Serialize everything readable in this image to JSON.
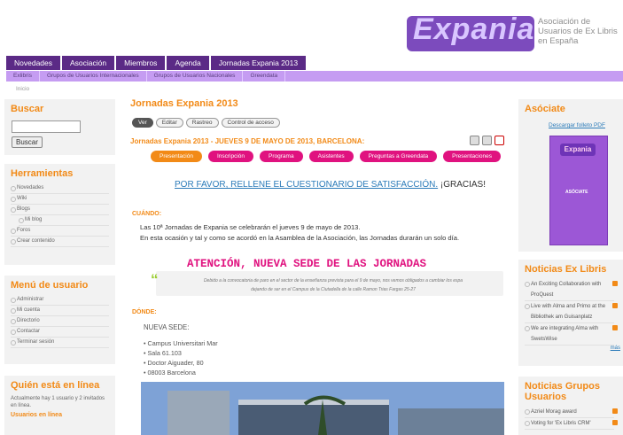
{
  "header": {
    "logo": "Expania",
    "association": [
      "Asociación de",
      "Usuarios de Ex Libris",
      "en España"
    ]
  },
  "nav": {
    "tabs": [
      "Novedades",
      "Asociación",
      "Miembros",
      "Agenda",
      "Jornadas Expania 2013"
    ],
    "subtabs": [
      "Exlibris",
      "Grupos de Usuarios Internacionales",
      "Grupos de Usuarios Nacionales",
      "Greendata"
    ]
  },
  "breadcrumb": "Inicio",
  "sidebar": {
    "search_title": "Buscar",
    "search_button": "Buscar",
    "tools_title": "Herramientas",
    "tools": [
      "Novedades",
      "Wiki",
      "Blogs",
      "Mi blog",
      "Foros",
      "Crear contenido"
    ],
    "usermenu_title": "Menú de usuario",
    "usermenu": [
      "Administrar",
      "Mi cuenta",
      "Directorio",
      "Contactar",
      "Terminar sesión"
    ],
    "online_title": "Quién está en línea",
    "online_text": "Actualmente hay 1 usuario y 2 invitados en línea.",
    "online_users": "Usuarios en línea"
  },
  "main": {
    "title": "Jornadas Expania 2013",
    "view_tabs": [
      "Ver",
      "Editar",
      "Rastreo",
      "Control de acceso"
    ],
    "subtitle": "Jornadas Expania 2013 - JUEVES 9 DE MAYO DE 2013, BARCELONA:",
    "pills": [
      "Presentación",
      "Inscripción",
      "Programa",
      "Asistentes",
      "Preguntas a Greendata",
      "Presentaciones"
    ],
    "survey_link": "POR FAVOR, RELLENE EL CUESTIONARIO DE SATISFACCIÓN.",
    "survey_tail": " ¡GRACIAS!",
    "cuando": "CUÁNDO:",
    "para1_line1": "Las 10ª Jornadas de Expania se celebrarán el jueves 9 de mayo de 2013.",
    "para1_line2": "En esta ocasión y tal y como se acordó en la Asamblea de la Asociación, las Jornadas durarán un solo día.",
    "atencion": "ATENCIÓN, NUEVA SEDE DE LAS JORNADAS",
    "quote_line1": "Debido a la convocatoria de paro en el sector de la enseñanza prevista para el 9 de mayo, nos vemos obligados a cambiar los espa",
    "quote_line2": "dejando de ser en el Campus de la Ciutadella de la calle Ramon Trias Fargas 25-27",
    "donde": "DÓNDE:",
    "nueva_sede": "NUEVA SEDE:",
    "address": [
      "Campus Universitari Mar",
      "Sala 61.103",
      "Doctor Aiguader, 80",
      "08003 Barcelona"
    ]
  },
  "right": {
    "asociate_title": "Asóciate",
    "asociate_link": "Descargar folleto PDF",
    "flyer_title": "ASÓCIATE",
    "news_title": "Noticias Ex Libris",
    "news": [
      "An Exciting Collaboration with ProQuest",
      "Live with Alma and Primo at the Bibliothek am Guisanplatz",
      "We are integrating Alma with SwetsWise"
    ],
    "more": "más",
    "groups_title": "Noticias Grupos Usuarios",
    "groups": [
      "Azriel Morag award",
      "Voting for 'Ex Libris CRM'"
    ]
  },
  "colors": {
    "orange": "#f28a17",
    "purple": "#5b2a86",
    "pink": "#e0127f",
    "lilac": "#c59cf2"
  }
}
